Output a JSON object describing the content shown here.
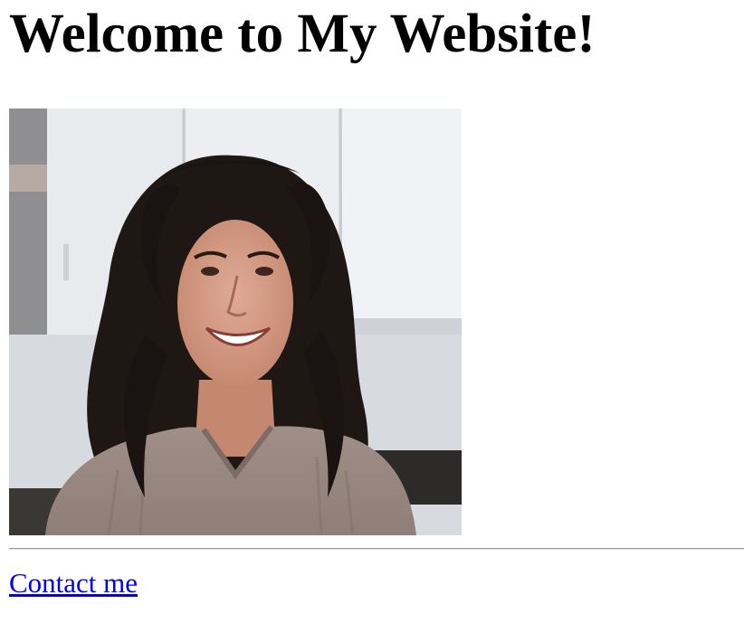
{
  "page": {
    "heading": "Welcome to My Website!",
    "contact_link_text": "Contact me"
  },
  "photo": {
    "description_icon": "portrait-photo"
  },
  "colors": {
    "link": "#0000ee",
    "text": "#000000",
    "background": "#ffffff"
  }
}
